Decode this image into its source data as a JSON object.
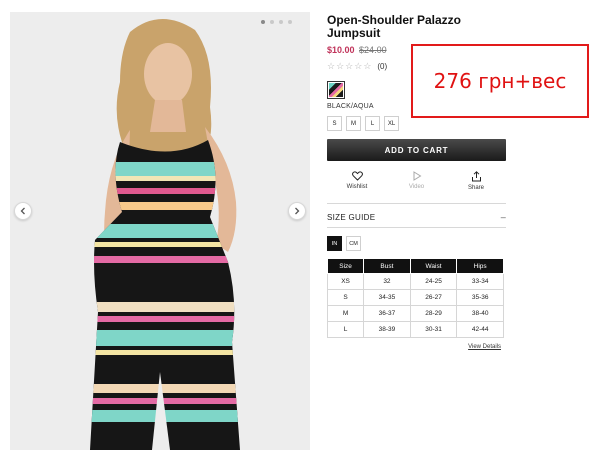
{
  "gallery": {
    "prev_icon": "chevron-left-icon",
    "next_icon": "chevron-right-icon",
    "dot_count": 4,
    "active_dot": 0
  },
  "product": {
    "title": "Open-Shoulder Palazzo Jumpsuit",
    "price": "$10.00",
    "original_price": "$24.00",
    "rating_stars": 0,
    "rating_max": 5,
    "review_count": "(0)",
    "color_name": "BLACK/AQUA",
    "sizes": [
      "S",
      "M",
      "L",
      "XL"
    ]
  },
  "actions": {
    "add_to_cart": "ADD TO CART",
    "wishlist": "Wishlist",
    "video": "Video",
    "share": "Share"
  },
  "size_guide": {
    "title": "SIZE GUIDE",
    "collapse_symbol": "–",
    "units": [
      "IN",
      "CM"
    ],
    "active_unit": "IN",
    "headers": [
      "Size",
      "Bust",
      "Waist",
      "Hips"
    ],
    "rows": [
      [
        "XS",
        "32",
        "24-25",
        "33-34"
      ],
      [
        "S",
        "34-35",
        "26-27",
        "35-36"
      ],
      [
        "M",
        "36-37",
        "28-29",
        "38-40"
      ],
      [
        "L",
        "38-39",
        "30-31",
        "42-44"
      ]
    ],
    "view_details": "View Details"
  },
  "annotation": {
    "text": "276 грн+вес",
    "color": "#e01212"
  },
  "colors": {
    "price_sale": "#c0335a",
    "button_dark": "#1a1a1a"
  }
}
